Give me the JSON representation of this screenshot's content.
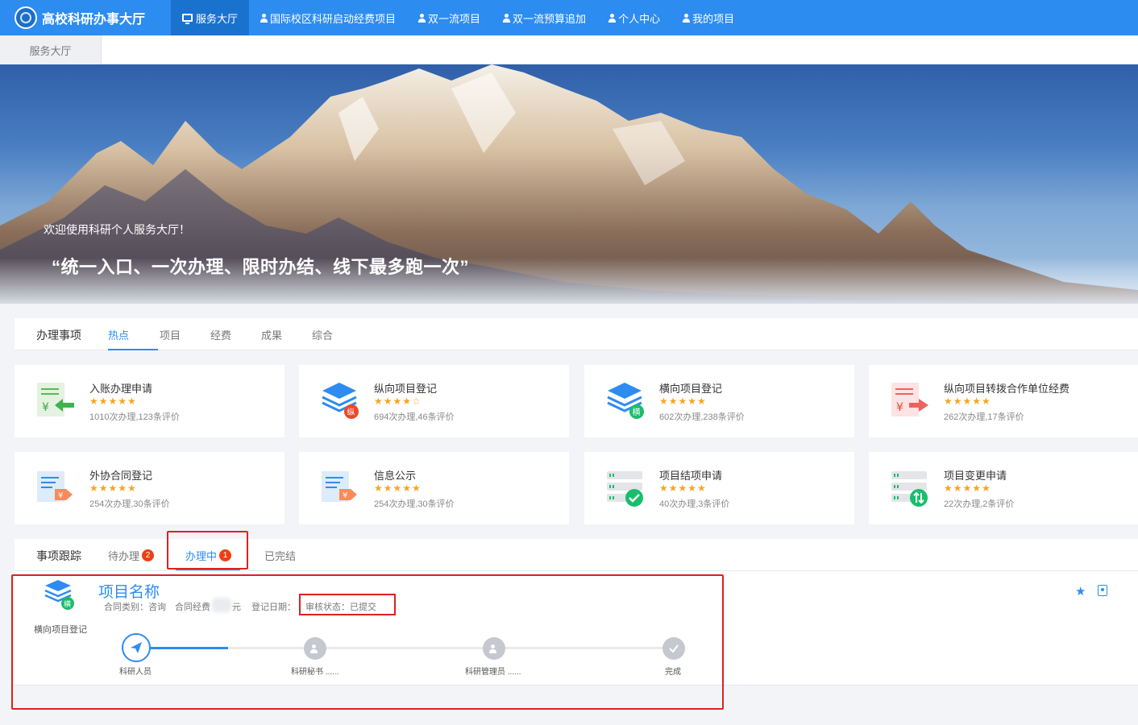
{
  "topnav": {
    "brand": "高校科研办事大厅",
    "items": [
      {
        "label": "服务大厅",
        "active": true,
        "icon": "monitor-icon"
      },
      {
        "label": "国际校区科研启动经费项目",
        "icon": "person-icon"
      },
      {
        "label": "双一流项目",
        "icon": "person-icon"
      },
      {
        "label": "双一流预算追加",
        "icon": "person-icon"
      },
      {
        "label": "个人中心",
        "icon": "person-icon"
      },
      {
        "label": "我的项目",
        "icon": "person-icon"
      }
    ]
  },
  "tabstrip": {
    "current": "服务大厅"
  },
  "banner": {
    "welcome": "欢迎使用科研个人服务大厅！",
    "slogan": "“统一入口、一次办理、限时办结、线下最多跑一次”"
  },
  "services": {
    "heading": "办理事项",
    "tabs": [
      "热点",
      "项目",
      "经费",
      "成果",
      "综合"
    ],
    "active_tab": "热点",
    "cards": [
      {
        "title": "入账办理申请",
        "stars": "★★★★★",
        "stats": "1010次办理,123条评价",
        "icon": "money-in-icon"
      },
      {
        "title": "纵向项目登记",
        "stars": "★★★★☆",
        "stats": "694次办理,46条评价",
        "icon": "layers-vertical-icon",
        "tag": "纵"
      },
      {
        "title": "横向项目登记",
        "stars": "★★★★★",
        "stats": "602次办理,238条评价",
        "icon": "layers-horizontal-icon",
        "tag": "横"
      },
      {
        "title": "纵向项目转拨合作单位经费",
        "stars": "★★★★★",
        "stats": "262次办理,17条评价",
        "icon": "money-transfer-icon"
      },
      {
        "title": "外协合同登记",
        "stars": "★★★★★",
        "stats": "254次办理,30条评价",
        "icon": "contract-icon"
      },
      {
        "title": "信息公示",
        "stars": "★★★★★",
        "stats": "254次办理,30条评价",
        "icon": "info-publish-icon"
      },
      {
        "title": "项目结项申请",
        "stars": "★★★★★",
        "stats": "40次办理,3条评价",
        "icon": "project-close-icon"
      },
      {
        "title": "项目变更申请",
        "stars": "★★★★★",
        "stats": "22次办理,2条评价",
        "icon": "project-change-icon"
      }
    ]
  },
  "tracking": {
    "heading": "事项跟踪",
    "tabs": [
      {
        "label": "待办理",
        "badge": "2"
      },
      {
        "label": "办理中",
        "badge": "1",
        "active": true
      },
      {
        "label": "已完结"
      }
    ],
    "item": {
      "type": "横向项目登记",
      "tag": "横",
      "name": "项目名称",
      "contract_type": "合同类别：咨询",
      "contract_fund_label": "合同经费",
      "fund_unit": "元",
      "register_date": "登记日期：",
      "status": "审核状态：已提交",
      "steps": [
        {
          "label": "科研人员",
          "state": "active"
        },
        {
          "label": "科研秘书 ......",
          "state": "pending"
        },
        {
          "label": "科研管理员 ......",
          "state": "pending"
        },
        {
          "label": "完成",
          "state": "done"
        }
      ],
      "progress": 0.17
    }
  },
  "colors": {
    "primary": "#2d8cf0",
    "alert": "#e02020",
    "star": "#f5a623"
  }
}
